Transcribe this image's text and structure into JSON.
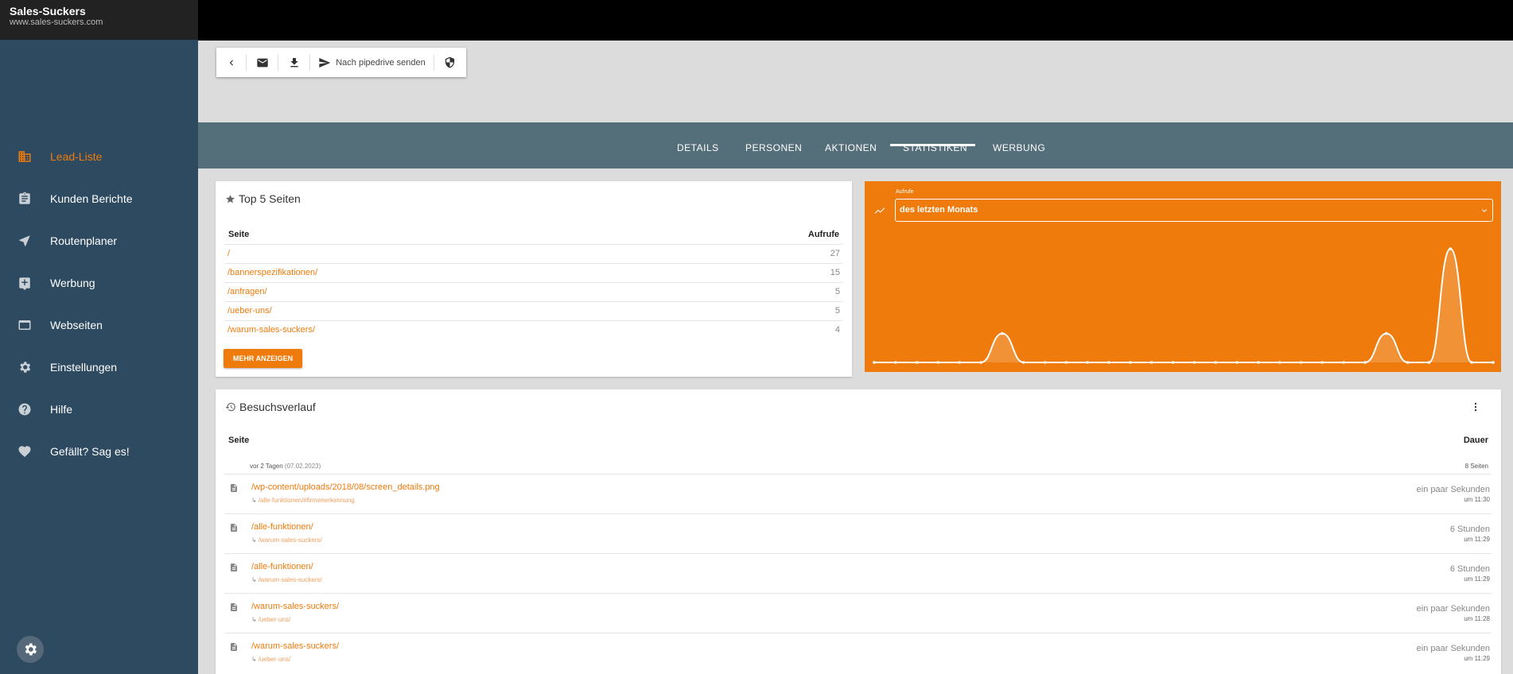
{
  "brand": {
    "title": "Sales-Suckers",
    "url": "www.sales-suckers.com"
  },
  "colors": {
    "accent": "#ef7b0c",
    "sidebar": "#2e4a60",
    "tabbar": "#546e7a"
  },
  "sidebar": {
    "items": [
      {
        "label": "Lead-Liste",
        "icon": "building-icon",
        "active": true
      },
      {
        "label": "Kunden Berichte",
        "icon": "clipboard-icon"
      },
      {
        "label": "Routenplaner",
        "icon": "navigation-icon"
      },
      {
        "label": "Werbung",
        "icon": "ad-icon"
      },
      {
        "label": "Webseiten",
        "icon": "browser-window-icon"
      },
      {
        "label": "Einstellungen",
        "icon": "gear-icon"
      },
      {
        "label": "Hilfe",
        "icon": "help-icon"
      },
      {
        "label": "Gefällt? Sag es!",
        "icon": "heart-icon"
      }
    ]
  },
  "toolbar": {
    "send_label": "Nach pipedrive senden"
  },
  "tabs": [
    "DETAILS",
    "PERSONEN",
    "AKTIONEN",
    "STATISTIKEN",
    "WERBUNG"
  ],
  "active_tab": "STATISTIKEN",
  "top_pages": {
    "title": "Top 5 Seiten",
    "col_page": "Seite",
    "col_views": "Aufrufe",
    "rows": [
      {
        "page": "/",
        "views": "27"
      },
      {
        "page": "/bannerspezifikationen/",
        "views": "15"
      },
      {
        "page": "/anfragen/",
        "views": "5"
      },
      {
        "page": "/ueber-uns/",
        "views": "5"
      },
      {
        "page": "/warum-sales-suckers/",
        "views": "4"
      }
    ],
    "more_label": "MEHR ANZEIGEN"
  },
  "views_chart": {
    "select_label": "Aufrufe",
    "select_value": "des letzten Monats",
    "chart_data": {
      "type": "area",
      "values": [
        0,
        0,
        0,
        0,
        0,
        0,
        1.4,
        0,
        0,
        0,
        0,
        0,
        0,
        0,
        0,
        0,
        0,
        0,
        0,
        0,
        0,
        0,
        0,
        0,
        1.4,
        0,
        0,
        5.5,
        0,
        0
      ]
    }
  },
  "history": {
    "title": "Besuchsverlauf",
    "col_page": "Seite",
    "col_duration": "Dauer",
    "group_date": "vor 2 Tagen",
    "group_date_detail": "(07.02.2023)",
    "group_count": "8 Seiten",
    "rows": [
      {
        "page": "/wp-content/uploads/2018/08/screen_details.png",
        "ref": "/alle-funktionen/#firmenerkennung",
        "duration": "ein paar Sekunden",
        "time": "um 11:30"
      },
      {
        "page": "/alle-funktionen/",
        "ref": "/warum-sales-suckers/",
        "duration": "6 Stunden",
        "time": "um 11:29"
      },
      {
        "page": "/alle-funktionen/",
        "ref": "/warum-sales-suckers/",
        "duration": "6 Stunden",
        "time": "um 11:29"
      },
      {
        "page": "/warum-sales-suckers/",
        "ref": "/ueber-uns/",
        "duration": "ein paar Sekunden",
        "time": "um 11:28"
      },
      {
        "page": "/warum-sales-suckers/",
        "ref": "/ueber-uns/",
        "duration": "ein paar Sekunden",
        "time": "um 11:29"
      }
    ]
  }
}
